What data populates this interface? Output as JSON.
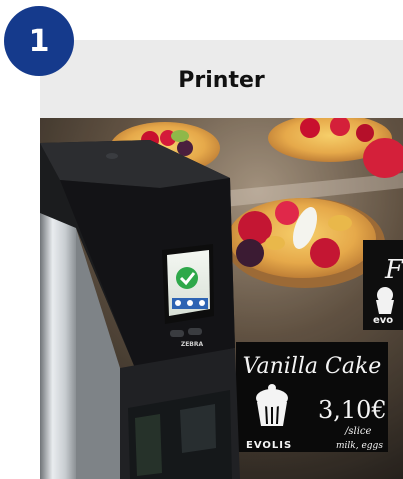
{
  "step": {
    "number": "1"
  },
  "card": {
    "title": "Printer",
    "accent_color": "#153a8c",
    "header_color": "#ebebeb"
  },
  "photo": {
    "sign_main": {
      "title": "Vanilla Cake",
      "price": "3,10€",
      "unit": "/slice",
      "brand": "EVOLIS",
      "note": "milk, eggs"
    },
    "sign_back": {
      "title_partial": "F",
      "brand_partial": "evo"
    },
    "printer": {
      "brand": "ZEBRA"
    }
  }
}
